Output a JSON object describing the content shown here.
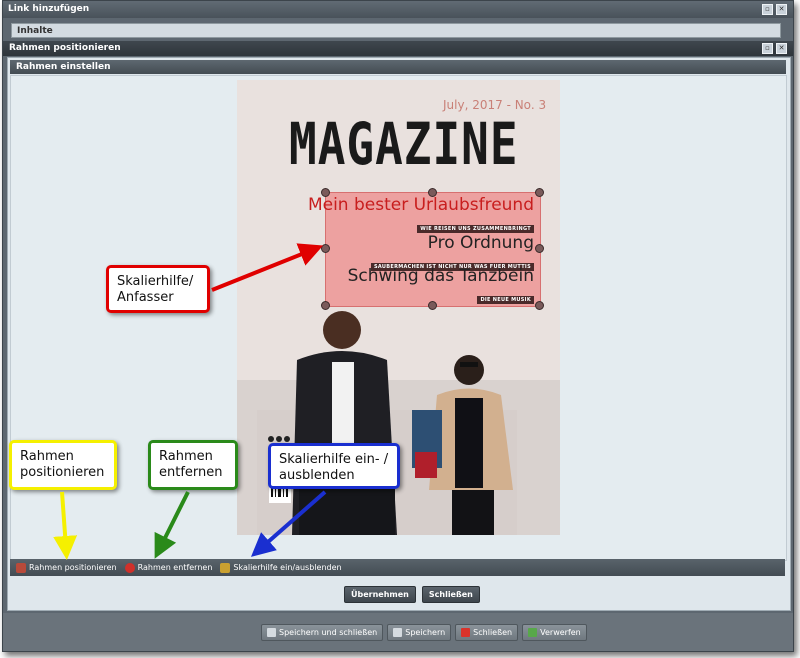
{
  "outer_window": {
    "title": "Link hinzufügen",
    "tab_label": "Inhalte"
  },
  "inner_window": {
    "title": "Rahmen positionieren",
    "panel_title": "Rahmen einstellen"
  },
  "magazine": {
    "issue": "July, 2017 - No. 3",
    "title": "MAGAZINE",
    "stories": [
      {
        "title": "Mein bester Urlaubsfreund",
        "subtitle": "WIE REISEN UNS ZUSAMMENBRINGT"
      },
      {
        "title": "Pro Ordnung",
        "subtitle": "SAUBERMACHEN IST NICHT NUR WAS FUER MUTTIS"
      },
      {
        "title": "Schwing das Tanzbein",
        "subtitle": "DIE NEUE MUSIK"
      }
    ]
  },
  "toolbar": {
    "items": [
      {
        "label": "Rahmen positionieren",
        "icon": "crop-tools-icon"
      },
      {
        "label": "Rahmen entfernen",
        "icon": "remove-icon"
      },
      {
        "label": "Skalierhilfe ein/ausblenden",
        "icon": "scale-helper-icon"
      }
    ]
  },
  "dialog_buttons": {
    "apply": "Übernehmen",
    "close": "Schließen"
  },
  "footer_buttons": {
    "save_close": "Speichern und schließen",
    "save": "Speichern",
    "close": "Schließen",
    "discard": "Verwerfen"
  },
  "callouts": {
    "handle": "Skalierhilfe/\nAnfasser",
    "position": "Rahmen\npositionieren",
    "remove": "Rahmen\nentfernen",
    "toggle": "Skalierhilfe ein- /\nausblenden"
  },
  "colors": {
    "callout_red": "#e00000",
    "callout_yellow": "#f5f000",
    "callout_green": "#2a8a1a",
    "callout_blue": "#1a2fd0",
    "selection_fill": "#f07070"
  }
}
